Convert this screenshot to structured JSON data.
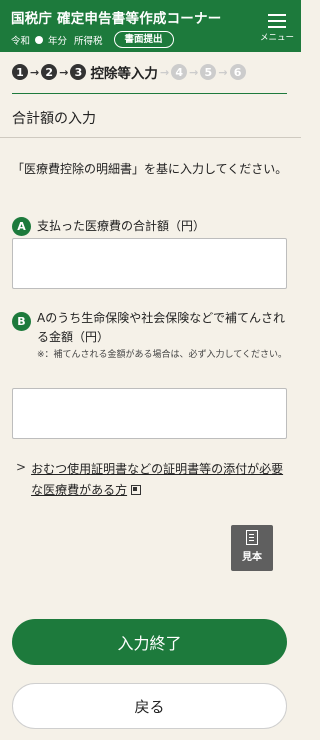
{
  "header": {
    "title": "国税庁 確定申告書等作成コーナー",
    "era": "令和",
    "year_suffix": "年分",
    "tax_type": "所得税",
    "submit_button": "書面提出",
    "menu_label": "メニュー"
  },
  "steps": {
    "items": [
      "1",
      "2",
      "3",
      "4",
      "5",
      "6"
    ],
    "current_index": 3,
    "current_label": "控除等入力"
  },
  "section": {
    "title": "合計額の入力"
  },
  "intro": "「医療費控除の明細書」を基に入力してください。",
  "question_a": {
    "badge": "A",
    "label": "支払った医療費の合計額（円）",
    "value": ""
  },
  "question_b": {
    "badge": "B",
    "label": "Aのうち生命保険や社会保険などで補てんされる金額（円）",
    "note": "※：補てんされる金額がある場合は、必ず入力してください。",
    "value": ""
  },
  "link": {
    "text": "おむつ使用証明書などの証明書等の添付が必要な医療費がある方"
  },
  "sample_button": "見本",
  "primary_button": "入力終了",
  "secondary_button": "戻る",
  "colors": {
    "brand_green": "#1d7a3c",
    "background": "#f5f1e8"
  }
}
